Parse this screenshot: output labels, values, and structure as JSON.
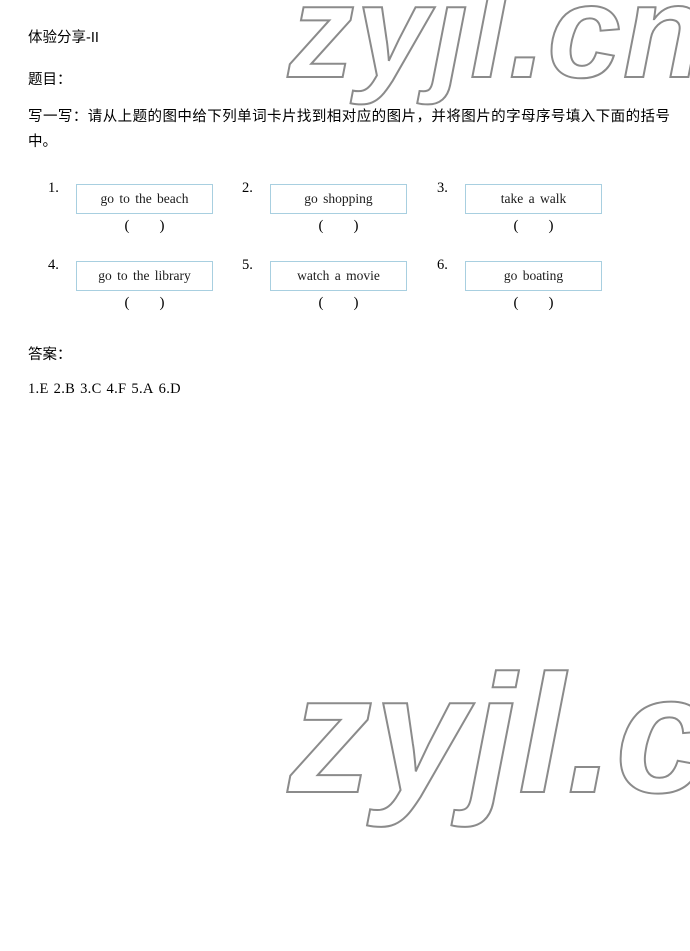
{
  "document": {
    "title": "体验分享-II",
    "section_label": "题目：",
    "instruction": "写一写：请从上题的图中给下列单词卡片找到相对应的图片，并将图片的字母序号填入下面的括号中。",
    "answer_label": "答案："
  },
  "watermark": {
    "text_top": "zyjl.cn",
    "text_bottom": "zyjl.cn",
    "color": "#8b8b8b"
  },
  "cards": {
    "border_color": "#a8cfe0",
    "blank": "(        )",
    "items": [
      {
        "number": "1.",
        "phrase": "go to the beach"
      },
      {
        "number": "2.",
        "phrase": "go shopping"
      },
      {
        "number": "3.",
        "phrase": "take a walk"
      },
      {
        "number": "4.",
        "phrase": "go to the library"
      },
      {
        "number": "5.",
        "phrase": "watch a movie"
      },
      {
        "number": "6.",
        "phrase": "go boating"
      }
    ]
  },
  "answers": {
    "items": [
      "1.E",
      "2.B",
      "3.C",
      "4.F",
      "5.A",
      "6.D"
    ],
    "joined": "1.E 2.B  3.C  4.F  5.A  6.D"
  }
}
